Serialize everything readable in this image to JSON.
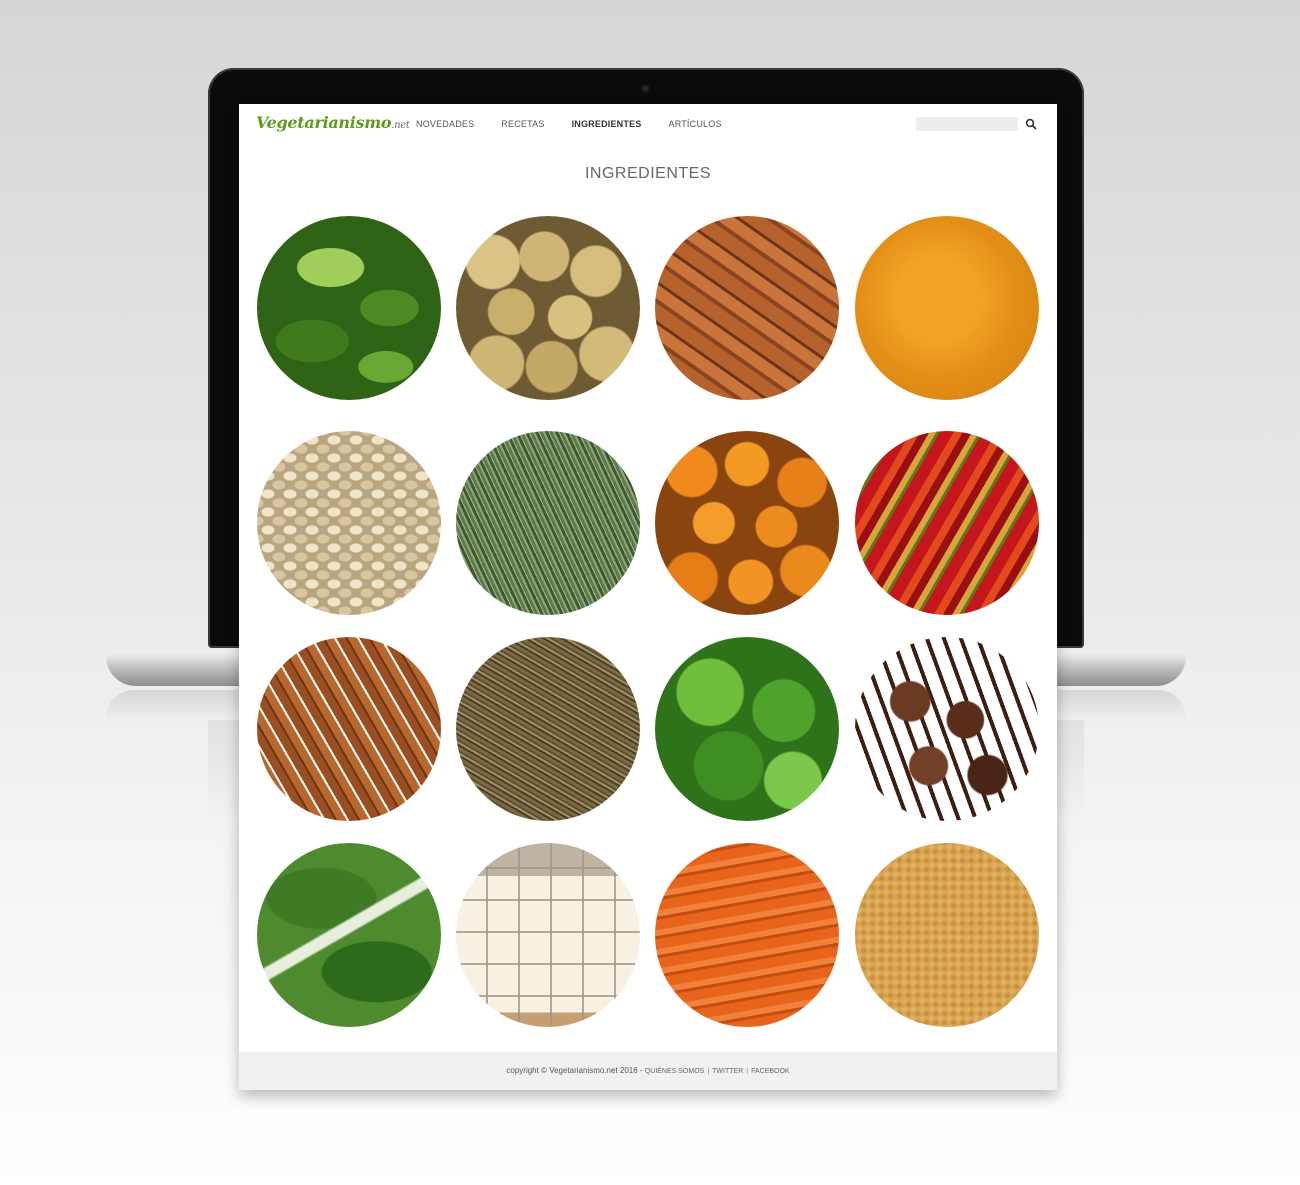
{
  "site": {
    "logo_text": "Vegetarianismo",
    "logo_tld": ".net"
  },
  "nav": {
    "items": [
      {
        "label": "NOVEDADES",
        "active": false
      },
      {
        "label": "RECETAS",
        "active": false
      },
      {
        "label": "INGREDIENTES",
        "active": true
      },
      {
        "label": "ARTÍCULOS",
        "active": false
      }
    ]
  },
  "search": {
    "placeholder": "",
    "value": "",
    "icon": "search-icon"
  },
  "page": {
    "title": "INGREDIENTES"
  },
  "ingredients": [
    {
      "key": "spinach"
    },
    {
      "key": "potato"
    },
    {
      "key": "turmeric"
    },
    {
      "key": "powder"
    },
    {
      "key": "oats"
    },
    {
      "key": "herbs"
    },
    {
      "key": "pumpkin"
    },
    {
      "key": "pepper"
    },
    {
      "key": "cinnamon"
    },
    {
      "key": "cumin"
    },
    {
      "key": "cilantro"
    },
    {
      "key": "clove"
    },
    {
      "key": "chard"
    },
    {
      "key": "tofu"
    },
    {
      "key": "carrot"
    },
    {
      "key": "crumbs"
    }
  ],
  "footer": {
    "copyright": "copyright © Vegetarianismo.net 2016 - ",
    "links": [
      "QUIÉNES SOMOS",
      "TWITTER",
      "FACEBOOK"
    ],
    "separator": "|"
  }
}
